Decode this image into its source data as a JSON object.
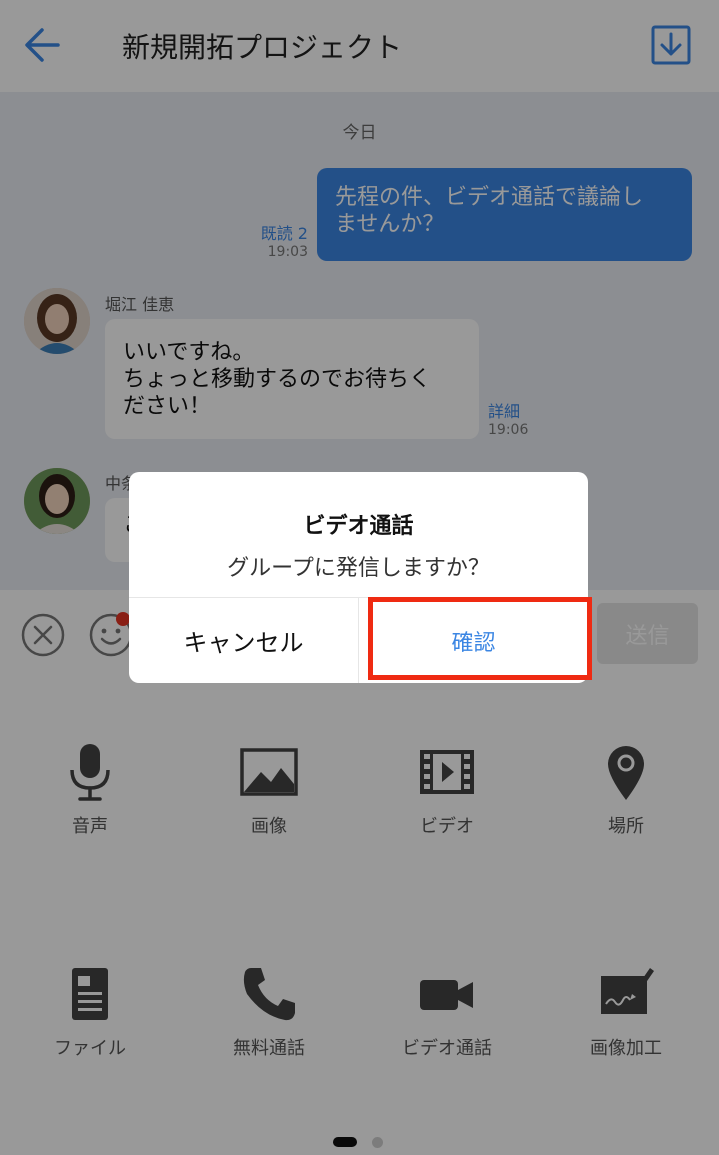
{
  "header": {
    "title": "新規開拓プロジェクト",
    "back_icon": "arrow-left-icon",
    "download_icon": "download-icon"
  },
  "chat": {
    "date_label": "今日",
    "messages": [
      {
        "direction": "sent",
        "lines": [
          "先程の件、ビデオ通話で議論し",
          "ませんか？"
        ],
        "read_status": "既読 2",
        "time": "19:03"
      },
      {
        "direction": "received",
        "sender": "堀江 佳恵",
        "lines": [
          "いいですね。",
          "ちょっと移動するのでお待ちく",
          "ださい！"
        ],
        "detail": "詳細",
        "time": "19:06"
      },
      {
        "direction": "received",
        "sender": "中条",
        "lines": [
          "こ"
        ]
      }
    ]
  },
  "input_bar": {
    "send_label": "送信",
    "close_icon": "close-circle-icon",
    "emoji_icon": "emoji-icon"
  },
  "attachments": {
    "items": [
      {
        "label": "音声",
        "icon": "microphone-icon"
      },
      {
        "label": "画像",
        "icon": "image-icon"
      },
      {
        "label": "ビデオ",
        "icon": "video-file-icon"
      },
      {
        "label": "場所",
        "icon": "location-pin-icon"
      },
      {
        "label": "ファイル",
        "icon": "file-icon"
      },
      {
        "label": "無料通話",
        "icon": "phone-icon"
      },
      {
        "label": "ビデオ通話",
        "icon": "video-camera-icon"
      },
      {
        "label": "画像加工",
        "icon": "image-edit-icon"
      }
    ],
    "page": 1,
    "page_count": 2
  },
  "dialog": {
    "title": "ビデオ通話",
    "message": "グループに発信しますか？",
    "cancel_label": "キャンセル",
    "confirm_label": "確認"
  },
  "colors": {
    "accent": "#3b86e3",
    "highlight": "#ef2a12",
    "chat_bg": "#e9edf3"
  }
}
